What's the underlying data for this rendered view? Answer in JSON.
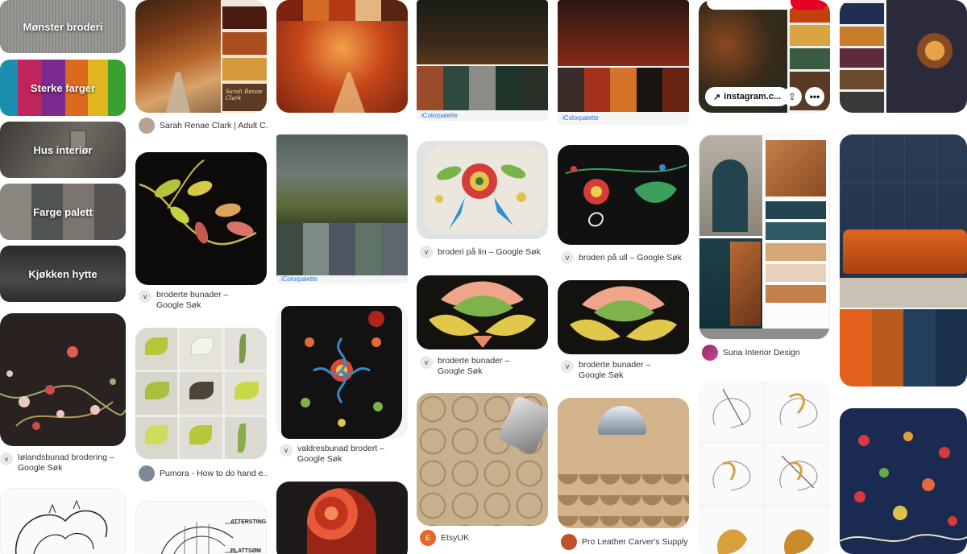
{
  "boards": [
    {
      "label": "Mønster broderi"
    },
    {
      "label": "Sterke farger"
    },
    {
      "label": "Hus interiør"
    },
    {
      "label": "Farge palett"
    },
    {
      "label": "Kjøkken hytte"
    }
  ],
  "pins": {
    "col1_embroidery_caption": "Iølandsbunad brodering – Google Søk",
    "col2_forest_source": "Sarah Renae Clark | Adult C...",
    "col2_leaves_caption": "broderte bunader – Google Søk",
    "col2_stitch_source": "Pumora - How to do hand e...",
    "col2_diagram_text1": "ATTERSTING",
    "col2_diagram_text2": "PLATTSØM",
    "col3_valdres_caption": "valdresbunad brodert – Google Søk",
    "col3_palette_brand": "iColorpalette",
    "col4_lin_caption": "broderi på lin – Google Søk",
    "col4_bunader_caption": "broderte bunader – Google Søk",
    "col4_leather_source": "EtsyUK",
    "col4_palette_brand": "iColorpalette",
    "col5_ull_caption": "broderi på ull – Google Søk",
    "col5_bunader_caption": "broderte bunader – Google Søk",
    "col5_leather_source": "Pro Leather Carver's Supply",
    "col5_palette_brand": "iColorpalette",
    "col6_instagram_link": "instagram.c...",
    "col6_interior_source": "Suna Interior Design",
    "col2_author_overlay": "Sarah Renae Clark"
  },
  "avatars": {
    "v": "v",
    "e": "E"
  },
  "colors": {
    "autumn_palette": [
      "#4a1c10",
      "#a84e1c",
      "#d49a3a",
      "#5c3b23"
    ],
    "forest_palette": [
      "#3d4b43",
      "#7d8b87",
      "#4e5663",
      "#5f7467",
      "#5e6670"
    ],
    "dark_forest_palette": [
      "#9a4b2c",
      "#2e4a3f",
      "#8c8c86",
      "#1f3529",
      "#2a3026"
    ],
    "red_forest_palette": [
      "#3a2a28",
      "#a3311c",
      "#d4742a",
      "#1a1411",
      "#6a2415"
    ],
    "col6_palette": [
      "#c2410c",
      "#d9a441",
      "#3b5b42",
      "#5a3a25"
    ],
    "interior_palette": [
      "#23434f",
      "#2e5a64",
      "#d5a678",
      "#c4804a"
    ],
    "sofa_palette": [
      "#e35f1c",
      "#b95b1c",
      "#23405f",
      "#1a314b"
    ],
    "jewel_palette": [
      "#1f2f52",
      "#c97c2a",
      "#5e2b3d",
      "#6b4a2e"
    ]
  }
}
